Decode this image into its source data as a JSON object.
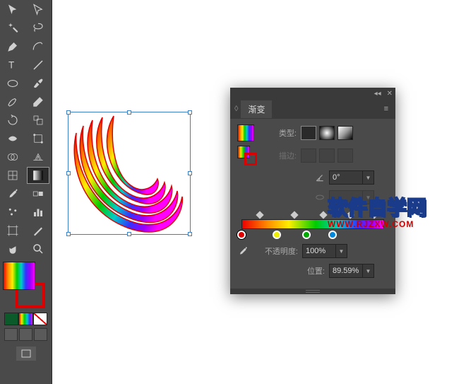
{
  "toolbox": {
    "tools": [
      "selection",
      "direct-selection",
      "magic-wand",
      "lasso",
      "pen",
      "curvature",
      "type",
      "line-segment",
      "ellipse",
      "paintbrush",
      "shaper",
      "eraser",
      "rotate",
      "scale",
      "width",
      "free-transform",
      "shape-builder",
      "perspective",
      "mesh",
      "gradient",
      "eyedropper",
      "blend",
      "symbol-sprayer",
      "column-graph",
      "artboard",
      "slice",
      "hand",
      "zoom"
    ],
    "selected": "gradient"
  },
  "fill_mode": {
    "solid_color": "#0a5a2a"
  },
  "panel": {
    "tab_label": "渐变",
    "type_label": "类型:",
    "stroke_label": "描边:",
    "angle_value": "0°",
    "opacity_label": "不透明度:",
    "opacity_value": "100%",
    "position_label": "位置:",
    "position_value": "89.59%",
    "gradient_stops": [
      {
        "pos": 2.7,
        "color": "#e00000",
        "selected": true
      },
      {
        "pos": 26,
        "color": "#eeee00",
        "selected": false
      },
      {
        "pos": 46,
        "color": "#00aa00",
        "selected": false
      },
      {
        "pos": 63,
        "color": "#0088dd",
        "selected": false
      }
    ],
    "diamonds": [
      13,
      36,
      55,
      73,
      89
    ]
  },
  "watermark": {
    "cn": "软件自学网",
    "url": "WWW.RJZXW.COM"
  }
}
